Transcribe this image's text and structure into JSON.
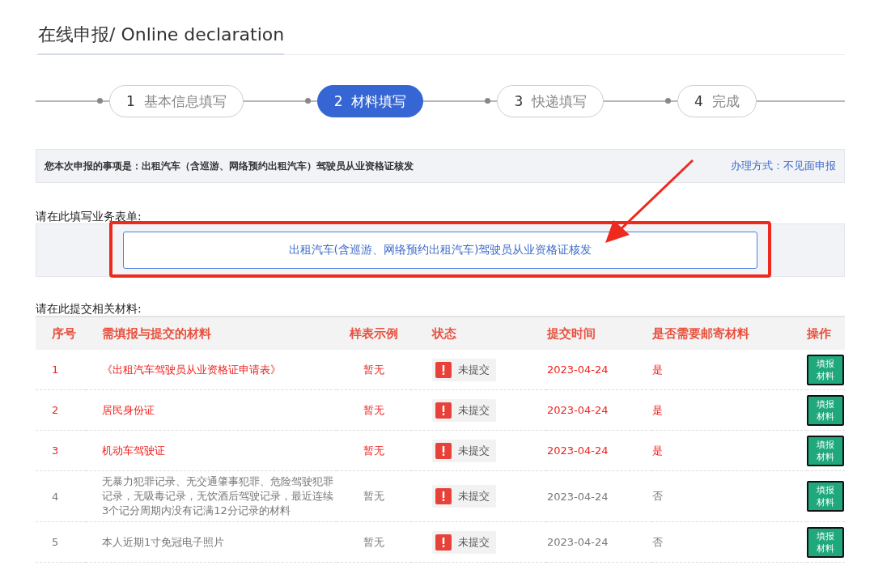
{
  "page_title": "在线申报/ Online declaration",
  "steps": [
    {
      "number": "1",
      "label": "基本信息填写",
      "selected": false
    },
    {
      "number": "2",
      "label": "材料填写",
      "selected": true
    },
    {
      "number": "3",
      "label": "快递填写",
      "selected": false
    },
    {
      "number": "4",
      "label": "完成",
      "selected": false
    }
  ],
  "notice": {
    "text": "您本次申报的事项是：出租汽车（含巡游、网络预约出租汽车）驾驶员从业资格证核发",
    "method": "办理方式：不见面申报"
  },
  "form_section": {
    "label": "请在此填写业务表单:",
    "form_button": "出租汽车(含巡游、网络预约出租汽车)驾驶员从业资格证核发"
  },
  "materials_section": {
    "label": "请在此提交相关材料:",
    "columns": [
      "序号",
      "需填报与提交的材料",
      "样表示例",
      "状态",
      "提交时间",
      "是否需要邮寄材料",
      "操作"
    ],
    "rows": [
      {
        "index": "1",
        "material": "《出租汽车驾驶员从业资格证申请表》",
        "sample": "暂无",
        "status": "未提交",
        "time": "2023-04-24",
        "mail": "是",
        "action": "填报材料",
        "required": true
      },
      {
        "index": "2",
        "material": "居民身份证",
        "sample": "暂无",
        "status": "未提交",
        "time": "2023-04-24",
        "mail": "是",
        "action": "填报材料",
        "required": true
      },
      {
        "index": "3",
        "material": "机动车驾驶证",
        "sample": "暂无",
        "status": "未提交",
        "time": "2023-04-24",
        "mail": "是",
        "action": "填报材料",
        "required": true
      },
      {
        "index": "4",
        "material": "无暴力犯罪记录、无交通肇事犯罪、危险驾驶犯罪记录，无吸毒记录，无饮酒后驾驶记录，最近连续3个记分周期内没有记满12分记录的材料",
        "sample": "暂无",
        "status": "未提交",
        "time": "2023-04-24",
        "mail": "否",
        "action": "填报材料",
        "required": false
      },
      {
        "index": "5",
        "material": "本人近期1寸免冠电子照片",
        "sample": "暂无",
        "status": "未提交",
        "time": "2023-04-24",
        "mail": "否",
        "action": "填报材料",
        "required": false
      }
    ]
  }
}
